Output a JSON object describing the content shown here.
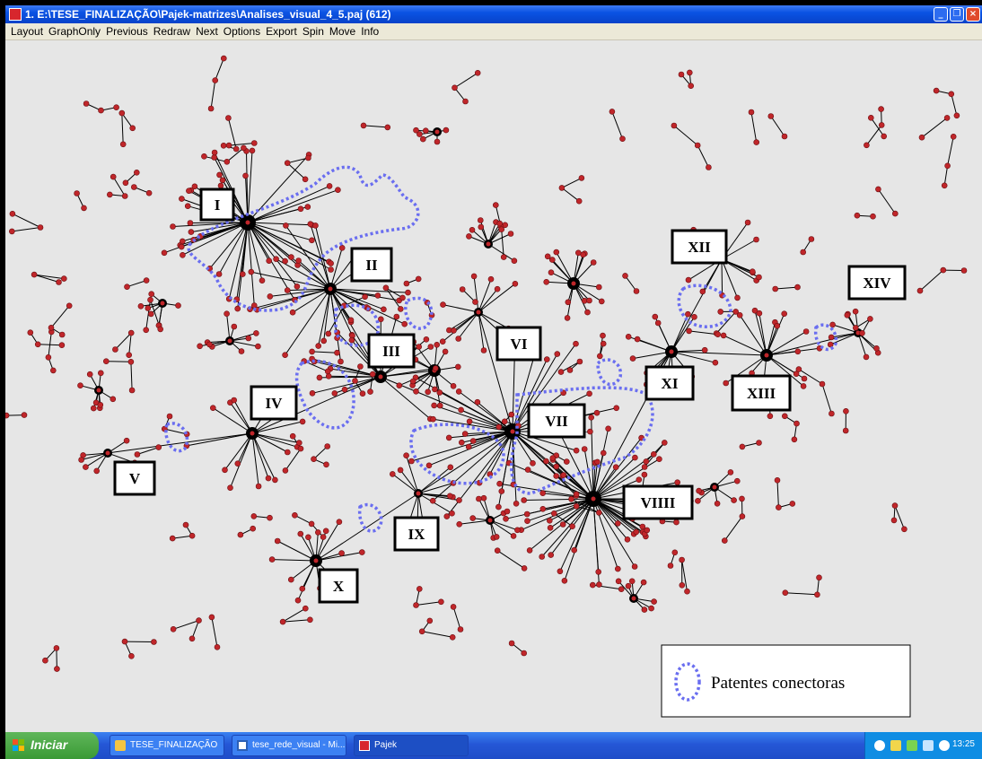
{
  "window": {
    "title": "1. E:\\TESE_FINALIZAÇÃO\\Pajek-matrizes\\Analises_visual_4_5.paj (612)",
    "controls": [
      "minimize",
      "restore",
      "close"
    ]
  },
  "menu": {
    "items": [
      "Layout",
      "GraphOnly",
      "Previous",
      "Redraw",
      "Next",
      "Options",
      "Export",
      "Spin",
      "Move",
      "Info"
    ]
  },
  "graph": {
    "clusters": [
      "I",
      "II",
      "III",
      "IV",
      "V",
      "VI",
      "VII",
      "VIIII",
      "IX",
      "X",
      "XI",
      "XII",
      "XIII",
      "XIV"
    ],
    "legend": {
      "label": "Patentes conectoras",
      "icon": "dotted-ellipse-icon"
    },
    "colors": {
      "node": "#c0262a",
      "edge": "#000000",
      "connector_outline": "#6a6ef0",
      "background": "#e6e6e6"
    }
  },
  "taskbar": {
    "start_label": "Iniciar",
    "tasks": [
      {
        "label": "TESE_FINALIZAÇÃO",
        "icon": "folder-icon"
      },
      {
        "label": "tese_rede_visual - Mi...",
        "icon": "word-document-icon"
      },
      {
        "label": "Pajek",
        "icon": "pajek-icon"
      }
    ],
    "clock": "13:25"
  }
}
